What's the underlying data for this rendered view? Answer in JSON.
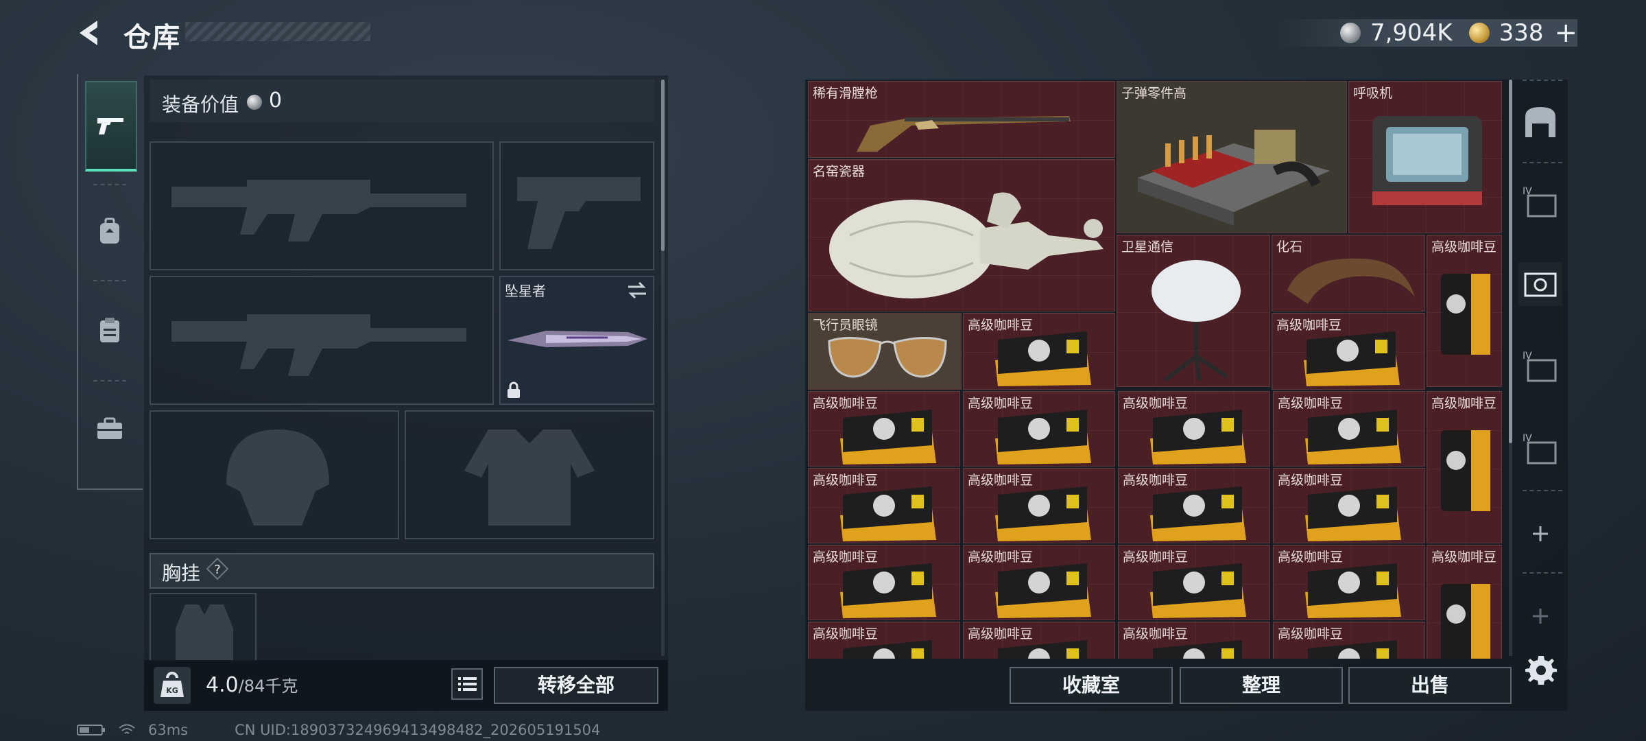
{
  "header": {
    "title": "仓库",
    "currency_silver": "7,904K",
    "currency_gold": "338",
    "plus": "+"
  },
  "tabs": [
    {
      "icon": "pistol-icon",
      "active": true
    },
    {
      "icon": "backpack-icon",
      "active": false
    },
    {
      "icon": "clipboard-icon",
      "active": false
    },
    {
      "icon": "toolbox-icon",
      "active": false
    }
  ],
  "equipment": {
    "value_label": "装备价值",
    "value": "0",
    "melee_name": "坠星者",
    "chest_label": "胸挂",
    "chest_help": "?"
  },
  "bottom_left": {
    "weight_value": "4.0",
    "weight_max": "/84千克",
    "kg_label": "KG",
    "transfer_all": "转移全部"
  },
  "storage": {
    "items": {
      "shotgun": "稀有滑膛枪",
      "ammo_parts": "子弹零件高",
      "respirator": "呼吸机",
      "vase": "名窑瓷器",
      "satellite": "卫星通信",
      "fossil": "化石",
      "goggles": "飞行员眼镜",
      "coffee": "高级咖啡豆"
    }
  },
  "buttons": {
    "collection": "收藏室",
    "organize": "整理",
    "sell": "出售"
  },
  "status": {
    "ping": "63ms",
    "uid": "CN UID:18903732496941349848​2_202605191504"
  },
  "colors": {
    "accent_green": "#5fe0b8",
    "item_bg": "#4a1f26"
  }
}
